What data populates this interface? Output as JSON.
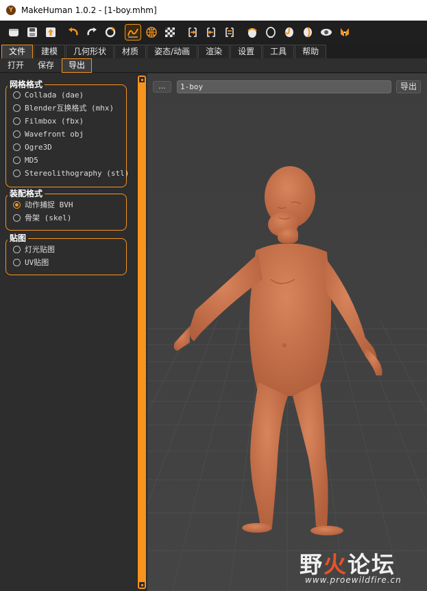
{
  "window": {
    "title": "MakeHuman 1.0.2 - [1-boy.mhm]"
  },
  "toolbar": {
    "buttons": [
      "rounded-box-icon",
      "save-icon",
      "export-icon",
      "undo-icon",
      "redo-icon",
      "reset-icon",
      "smooth-icon",
      "wireframe-icon",
      "background-icon",
      "front-view-icon",
      "left-view-icon",
      "right-view-icon",
      "top-view-icon",
      "back-view-icon",
      "bottom-view-icon",
      "global-view-icon",
      "camera-icon",
      "grab-icon"
    ],
    "active": [
      "smooth-icon"
    ]
  },
  "tabs": [
    {
      "label": "文件",
      "active": true
    },
    {
      "label": "建模",
      "active": false
    },
    {
      "label": "几何形状",
      "active": false
    },
    {
      "label": "材质",
      "active": false
    },
    {
      "label": "姿态/动画",
      "active": false
    },
    {
      "label": "渲染",
      "active": false
    },
    {
      "label": "设置",
      "active": false
    },
    {
      "label": "工具",
      "active": false
    },
    {
      "label": "帮助",
      "active": false
    }
  ],
  "subtabs": [
    {
      "label": "打开",
      "active": false
    },
    {
      "label": "保存",
      "active": false
    },
    {
      "label": "导出",
      "active": true
    }
  ],
  "groups": {
    "mesh": {
      "title": "网格格式",
      "options": [
        {
          "label": "Collada (dae)",
          "checked": false
        },
        {
          "label": "Blender互换格式 (mhx)",
          "checked": false
        },
        {
          "label": "Filmbox (fbx)",
          "checked": false
        },
        {
          "label": "Wavefront obj",
          "checked": false
        },
        {
          "label": "Ogre3D",
          "checked": false
        },
        {
          "label": "MD5",
          "checked": false
        },
        {
          "label": "Stereolithography (stl)",
          "checked": false
        }
      ]
    },
    "rig": {
      "title": "装配格式",
      "options": [
        {
          "label": "动作捕捉 BVH",
          "checked": true
        },
        {
          "label": "骨架  (skel)",
          "checked": false
        }
      ]
    },
    "map": {
      "title": "贴图",
      "options": [
        {
          "label": "灯光贴图",
          "checked": false
        },
        {
          "label": "UV贴图",
          "checked": false
        }
      ]
    }
  },
  "viewport": {
    "browse_label": "...",
    "filename": "1-boy",
    "export_label": "导出"
  },
  "watermark": {
    "text_a": "野",
    "text_b": "火",
    "text_c": "论坛",
    "url": "www.proewildfire.cn"
  },
  "colors": {
    "accent": "#f7941d",
    "skin": "#c8714a",
    "panel": "#2d2d2d"
  }
}
